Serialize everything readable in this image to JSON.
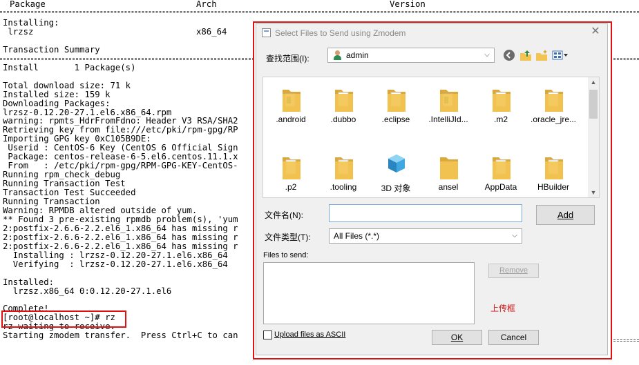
{
  "terminal": {
    "header": {
      "package": "Package",
      "arch": "Arch",
      "version": "Version"
    },
    "lines": [
      "Installing:",
      " lrzsz",
      "",
      "Transaction Summary",
      "",
      "Install       1 Package(s)",
      "",
      "Total download size: 71 k",
      "Installed size: 159 k",
      "Downloading Packages:",
      "lrzsz-0.12.20-27.1.el6.x86_64.rpm",
      "warning: rpmts_HdrFromFdno: Header V3 RSA/SHA2",
      "Retrieving key from file:///etc/pki/rpm-gpg/RP",
      "Importing GPG key 0xC105B9DE:",
      " Userid : CentOS-6 Key (CentOS 6 Official Sign",
      " Package: centos-release-6-5.el6.centos.11.1.x",
      " From   : /etc/pki/rpm-gpg/RPM-GPG-KEY-CentOS-",
      "Running rpm_check_debug",
      "Running Transaction Test",
      "Transaction Test Succeeded",
      "Running Transaction",
      "Warning: RPMDB altered outside of yum.",
      "** Found 3 pre-existing rpmdb problem(s), 'yum",
      "2:postfix-2.6.6-2.2.el6_1.x86_64 has missing r",
      "2:postfix-2.6.6-2.2.el6_1.x86_64 has missing r",
      "2:postfix-2.6.6-2.2.el6_1.x86_64 has missing r",
      "  Installing : lrzsz-0.12.20-27.1.el6.x86_64",
      "  Verifying  : lrzsz-0.12.20-27.1.el6.x86_64",
      "",
      "Installed:",
      "  lrzsz.x86_64 0:0.12.20-27.1.el6",
      "",
      "Complete!",
      "[root@localhost ~]# rz",
      "rz waiting to receive.",
      "Starting zmodem transfer.  Press Ctrl+C to can"
    ],
    "arch_value": "x86_64"
  },
  "dialog": {
    "title": "Select Files to Send using Zmodem",
    "close_glyph": "✕",
    "lookin_label": "查找范围(I):",
    "lookin_value": "admin",
    "files": [
      {
        "name": ".android",
        "icon": "folder-doc-icon"
      },
      {
        "name": ".dubbo",
        "icon": "folder-icon"
      },
      {
        "name": ".eclipse",
        "icon": "folder-icon"
      },
      {
        "name": ".IntelliJId...",
        "icon": "folder-doc-icon"
      },
      {
        "name": ".m2",
        "icon": "folder-icon"
      },
      {
        "name": ".oracle_jre...",
        "icon": "folder-icon"
      },
      {
        "name": ".p2",
        "icon": "folder-icon"
      },
      {
        "name": ".tooling",
        "icon": "folder-icon"
      },
      {
        "name": "3D 对象",
        "icon": "3d-objects-icon"
      },
      {
        "name": "ansel",
        "icon": "folder-plain-icon"
      },
      {
        "name": "AppData",
        "icon": "folder-icon"
      },
      {
        "name": "HBuilder",
        "icon": "folder-icon"
      }
    ],
    "filename_label": "文件名(N):",
    "filename_value": "",
    "filetype_label": "文件类型(T):",
    "filetype_value": "All Files (*.*)",
    "files_to_send_label": "Files to send:",
    "add_label": "Add",
    "remove_label": "Remove",
    "upload_ascii_label": "Upload files as ASCII",
    "ok_label": "OK",
    "cancel_label": "Cancel",
    "annotation": "上传框"
  },
  "colors": {
    "annotation": "#e01010",
    "folder": "#f3c451",
    "folder_dark": "#dba93a"
  }
}
